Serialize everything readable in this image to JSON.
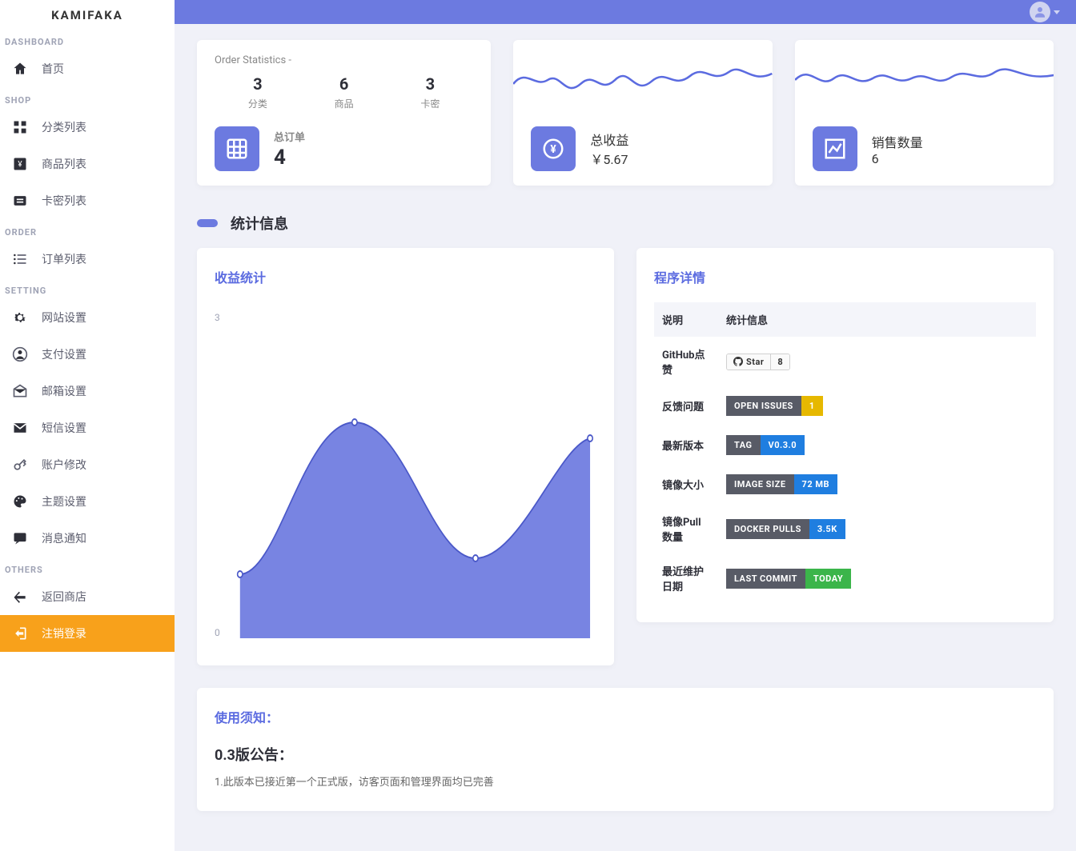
{
  "brand": "KAMIFAKA",
  "sidebar": {
    "sections": [
      {
        "title": "DASHBOARD",
        "items": [
          {
            "label": "首页",
            "icon": "home"
          }
        ]
      },
      {
        "title": "SHOP",
        "items": [
          {
            "label": "分类列表",
            "icon": "grid"
          },
          {
            "label": "商品列表",
            "icon": "yen-box"
          },
          {
            "label": "卡密列表",
            "icon": "list-box"
          }
        ]
      },
      {
        "title": "ORDER",
        "items": [
          {
            "label": "订单列表",
            "icon": "list"
          }
        ]
      },
      {
        "title": "SETTING",
        "items": [
          {
            "label": "网站设置",
            "icon": "gear"
          },
          {
            "label": "支付设置",
            "icon": "user-circle"
          },
          {
            "label": "邮箱设置",
            "icon": "mail-open"
          },
          {
            "label": "短信设置",
            "icon": "mail"
          },
          {
            "label": "账户修改",
            "icon": "key"
          },
          {
            "label": "主题设置",
            "icon": "palette"
          },
          {
            "label": "消息通知",
            "icon": "chat"
          }
        ]
      },
      {
        "title": "OTHERS",
        "items": [
          {
            "label": "返回商店",
            "icon": "back"
          },
          {
            "label": "注销登录",
            "icon": "logout",
            "active": true
          }
        ]
      }
    ]
  },
  "order_stats": {
    "title": "Order Statistics -",
    "trio": [
      {
        "num": "3",
        "lbl": "分类"
      },
      {
        "num": "6",
        "lbl": "商品"
      },
      {
        "num": "3",
        "lbl": "卡密"
      }
    ],
    "total_orders_label": "总订单",
    "total_orders": "4"
  },
  "revenue_card": {
    "label": "总收益",
    "value": "￥5.67"
  },
  "sales_card": {
    "label": "销售数量",
    "value": "6"
  },
  "section_stats_title": "统计信息",
  "chart_title": "收益统计",
  "chart_data": {
    "type": "area",
    "title": "收益统计",
    "ylim": [
      0,
      3
    ],
    "y_ticks": [
      0,
      3
    ],
    "points": [
      {
        "x": 0,
        "y": 0.6
      },
      {
        "x": 1,
        "y": 1.9
      },
      {
        "x": 2,
        "y": 0.8
      },
      {
        "x": 3,
        "y": 1.8
      }
    ]
  },
  "program_info": {
    "title": "程序详情",
    "head_desc": "说明",
    "head_stat": "统计信息",
    "rows": {
      "github": {
        "label": "GitHub点赞",
        "badge_l": "Star",
        "badge_r": "8"
      },
      "issues": {
        "label": "反馈问题",
        "badge_l": "OPEN ISSUES",
        "badge_r": "1",
        "color": "#e6b800"
      },
      "tag": {
        "label": "最新版本",
        "badge_l": "TAG",
        "badge_r": "V0.3.0",
        "color": "#1f7ee0"
      },
      "image": {
        "label": "镜像大小",
        "badge_l": "IMAGE SIZE",
        "badge_r": "72 MB",
        "color": "#1f7ee0"
      },
      "pulls": {
        "label": "镜像Pull数量",
        "badge_l": "DOCKER PULLS",
        "badge_r": "3.5K",
        "color": "#1f7ee0"
      },
      "commit": {
        "label": "最近维护日期",
        "badge_l": "LAST COMMIT",
        "badge_r": "TODAY",
        "color": "#3bb54a"
      }
    }
  },
  "notice": {
    "title": "使用须知：",
    "heading": "0.3版公告：",
    "line1": "1.此版本已接近第一个正式版，访客页面和管理界面均已完善"
  }
}
